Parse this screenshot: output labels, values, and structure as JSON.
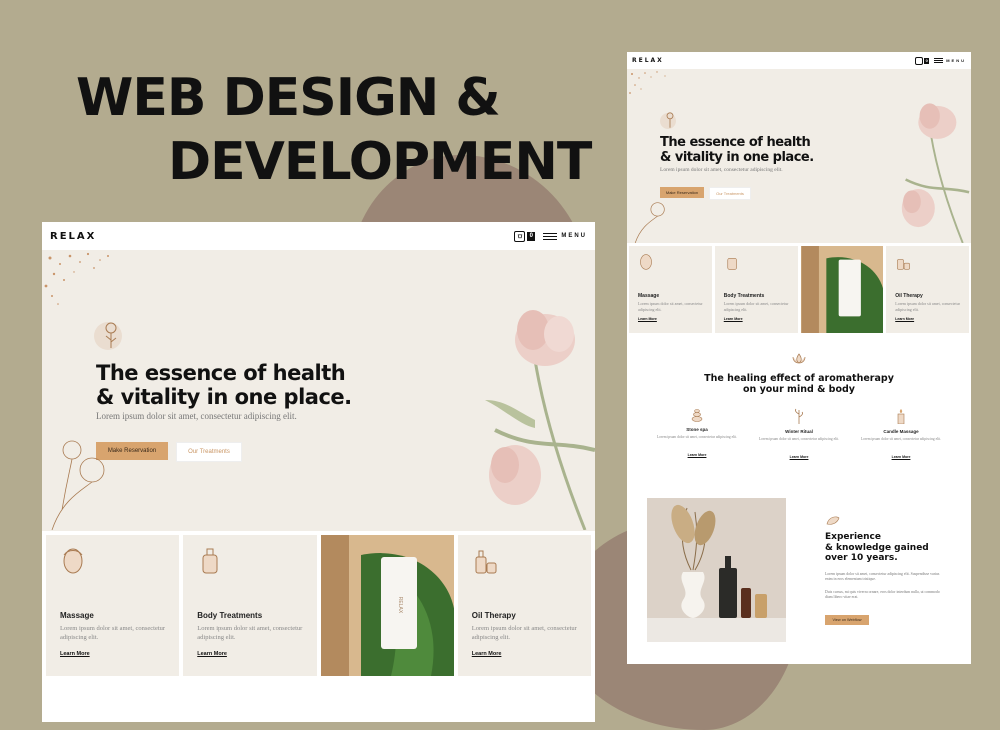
{
  "poster": {
    "headline_line_1": "WEB DESIGN &",
    "headline_line_2": "DEVELOPMENT",
    "background_color": "#b3ab8f",
    "blob_color": "#9b8676"
  },
  "site": {
    "logo": "RELAX",
    "cart_count": "0",
    "menu_label": "MENU",
    "hero": {
      "title_line_1": "The essence of health",
      "title_line_2": "& vitality in one place.",
      "subtitle": "Lorem ipsum dolor sit amet, consectetur adipiscing elit.",
      "primary_button": "Make Reservation",
      "secondary_button": "Our Treatments"
    },
    "cards": [
      {
        "title": "Massage",
        "text": "Lorem ipsum dolor sit amet, consectetur adipiscing elit.",
        "link": "Learn More"
      },
      {
        "title": "Body Treatments",
        "text": "Lorem ipsum dolor sit amet, consectetur adipiscing elit.",
        "link": "Learn More"
      },
      {
        "title": "Oil Therapy",
        "text": "Lorem ipsum dolor sit amet, consectetur adipiscing elit.",
        "link": "Learn More"
      }
    ],
    "photo_product_label": "RELAX",
    "aromatherapy": {
      "title_line_1": "The healing effect of aromatherapy",
      "title_line_2": "on your mind & body",
      "features": [
        {
          "title": "Stone spa",
          "text": "Lorem ipsum dolor sit amet, consectetur adipiscing elit.",
          "link": "Learn More"
        },
        {
          "title": "Winter Ritual",
          "text": "Lorem ipsum dolor sit amet, consectetur adipiscing elit.",
          "link": "Learn More"
        },
        {
          "title": "Candle Massage",
          "text": "Lorem ipsum dolor sit amet, consectetur adipiscing elit.",
          "link": "Learn More"
        }
      ]
    },
    "experience": {
      "title_line_1": "Experience",
      "title_line_2": "& knowledge gained",
      "title_line_3": "over 10 years.",
      "text_1": "Lorem ipsum dolor sit amet, consectetur adipiscing elit. Suspendisse varius enim in eros elementum tristique.",
      "text_2": "Duis cursus, mi quis viverra ornare, eros dolor interdum nulla, ut commodo diam libero vitae erat.",
      "button": "View on Webflow"
    },
    "colors": {
      "accent": "#d8a46e",
      "hero_bg": "#f1ede6",
      "text": "#111111"
    }
  }
}
